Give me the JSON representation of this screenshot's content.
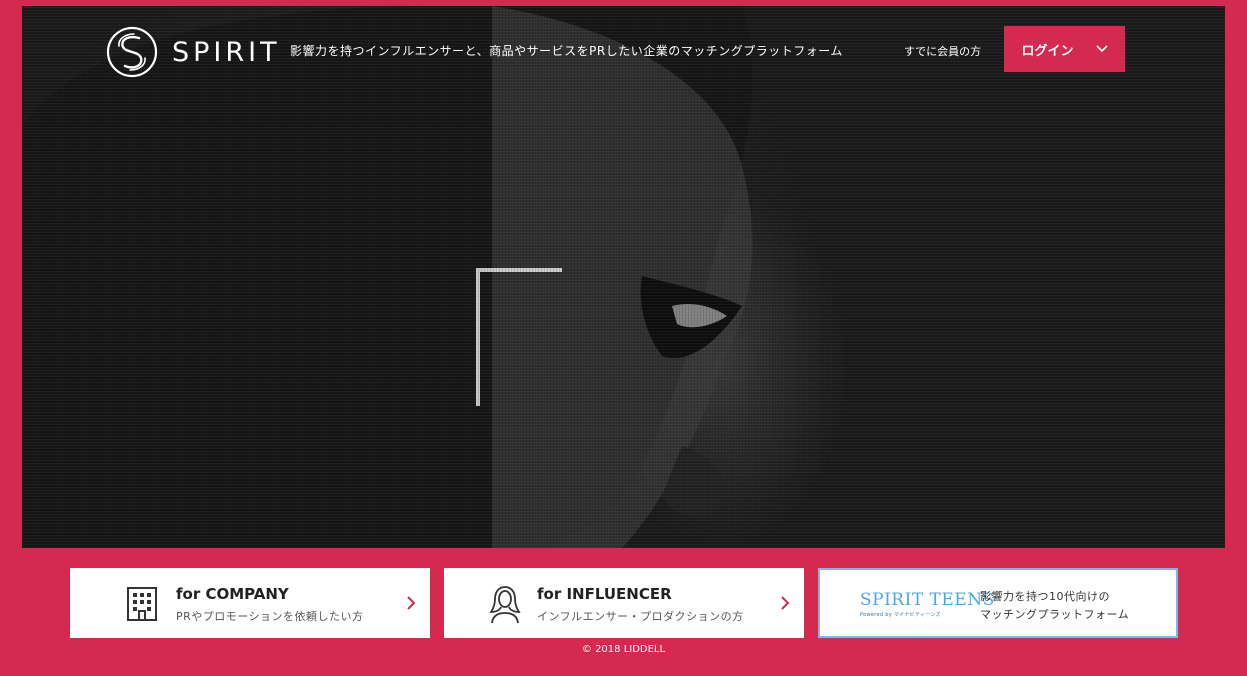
{
  "header": {
    "brand": "SPIRIT",
    "tagline": "影響力を持つインフルエンサーと、商品やサービスをPRしたい企業のマッチングプラットフォーム",
    "member_text": "すでに会員の方",
    "login_label": "ログイン"
  },
  "cards": {
    "company": {
      "title": "for COMPANY",
      "subtitle": "PRやプロモーションを依頼したい方",
      "icon": "building-icon"
    },
    "influencer": {
      "title": "for INFLUENCER",
      "subtitle": "インフルエンサー・プロダクションの方",
      "icon": "woman-icon"
    },
    "teens": {
      "logo_text": "SPIRIT TEENS",
      "powered": "Powered by マイナビティーンズ",
      "desc_line1": "影響力を持つ10代向けの",
      "desc_line2": "マッチングプラットフォーム"
    }
  },
  "footer": {
    "copyright": "© 2018 LIDDELL"
  },
  "colors": {
    "brand": "#d42a52",
    "teens_blue": "#4aa9df"
  }
}
